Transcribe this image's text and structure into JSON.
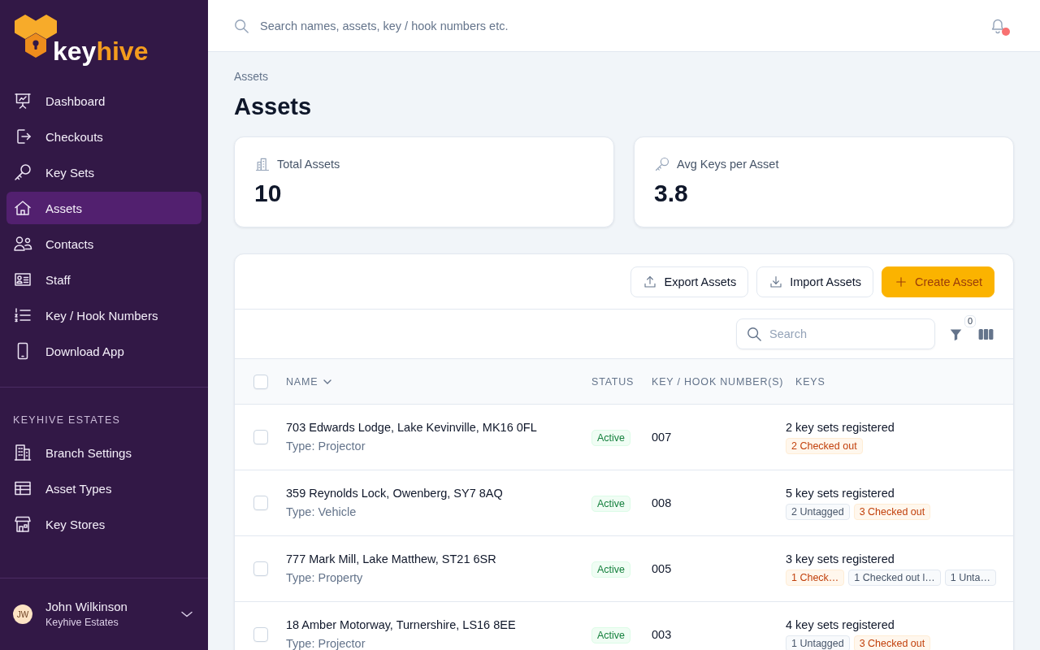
{
  "sidebar": {
    "logo": {
      "text": "key",
      "accent": "hive"
    },
    "nav": [
      {
        "label": "Dashboard",
        "selected": false
      },
      {
        "label": "Checkouts",
        "selected": false
      },
      {
        "label": "Key Sets",
        "selected": false
      },
      {
        "label": "Assets",
        "selected": true
      },
      {
        "label": "Contacts",
        "selected": false
      },
      {
        "label": "Staff",
        "selected": false
      },
      {
        "label": "Key / Hook Numbers",
        "selected": false
      },
      {
        "label": "Download App",
        "selected": false
      }
    ],
    "section": {
      "title": "KEYHIVE ESTATES",
      "items": [
        {
          "label": "Branch Settings",
          "selected": false
        },
        {
          "label": "Asset Types",
          "selected": false
        },
        {
          "label": "Key Stores",
          "selected": false
        }
      ]
    },
    "user": {
      "initials": "JW",
      "name": "John Wilkinson",
      "org": "Keyhive Estates"
    }
  },
  "topbar": {
    "search": {
      "placeholder": "Search names, assets, key / hook numbers etc."
    },
    "notifications": {
      "unread": true
    }
  },
  "breadcrumb": [
    "Assets"
  ],
  "title": "Assets",
  "stats": [
    {
      "label": "Total Assets",
      "value": "10"
    },
    {
      "label": "Avg Keys per Asset",
      "value": "3.8"
    }
  ],
  "table": {
    "actions": [
      {
        "label": "Export Assets",
        "kind": "secondary"
      },
      {
        "label": "Import Assets",
        "kind": "secondary"
      },
      {
        "label": "Create Asset",
        "kind": "primary"
      }
    ],
    "search": {
      "placeholder": "Search"
    },
    "filter_count": "0",
    "select_all": {
      "checked": false
    },
    "columns": [
      {
        "label": "NAME",
        "sorted": true
      },
      {
        "label": "STATUS",
        "sorted": false
      },
      {
        "label": "KEY / HOOK NUMBER(S)",
        "sorted": false
      },
      {
        "label": "KEYS",
        "sorted": false
      }
    ],
    "rows": [
      {
        "checked": false,
        "name": "703 Edwards Lodge, Lake Kevinville, MK16 0FL",
        "type": "Type: Projector",
        "status": {
          "text": "Active",
          "kind": "active"
        },
        "key_number": "007",
        "keys_summary": "2 key sets registered",
        "tags": [
          {
            "text": "2 Checked out",
            "kind": "warning"
          }
        ]
      },
      {
        "checked": false,
        "name": "359 Reynolds Lock, Owenberg, SY7 8AQ",
        "type": "Type: Vehicle",
        "status": {
          "text": "Active",
          "kind": "active"
        },
        "key_number": "008",
        "keys_summary": "5 key sets registered",
        "tags": [
          {
            "text": "2 Untagged",
            "kind": "neutral"
          },
          {
            "text": "3 Checked out",
            "kind": "warning"
          }
        ]
      },
      {
        "checked": false,
        "name": "777 Mark Mill, Lake Matthew, ST21 6SR",
        "type": "Type: Property",
        "status": {
          "text": "Active",
          "kind": "active"
        },
        "key_number": "005",
        "keys_summary": "3 key sets registered",
        "tags": [
          {
            "text": "1 Check…",
            "kind": "warning"
          },
          {
            "text": "1 Checked out l…",
            "kind": "neutral"
          },
          {
            "text": "1 Unta…",
            "kind": "neutral"
          }
        ]
      },
      {
        "checked": false,
        "name": "18 Amber Motorway, Turnershire, LS16 8EE",
        "type": "Type: Projector",
        "status": {
          "text": "Active",
          "kind": "active"
        },
        "key_number": "003",
        "keys_summary": "4 key sets registered",
        "tags": [
          {
            "text": "1 Untagged",
            "kind": "neutral"
          },
          {
            "text": "3 Checked out",
            "kind": "warning"
          }
        ]
      }
    ]
  }
}
